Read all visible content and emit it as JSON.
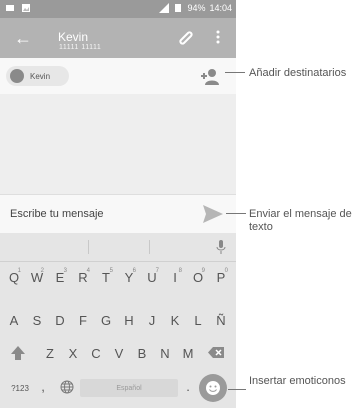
{
  "status": {
    "battery": "94%",
    "time": "14:04"
  },
  "header": {
    "title": "Kevin",
    "subtitle": "11111 11111"
  },
  "recipients": [
    {
      "name": "Kevin"
    }
  ],
  "compose": {
    "placeholder": "Escribe tu mensaje"
  },
  "keyboard": {
    "row1": [
      "Q",
      "W",
      "E",
      "R",
      "T",
      "Y",
      "U",
      "I",
      "O",
      "P"
    ],
    "row1_numbers": [
      "1",
      "2",
      "3",
      "4",
      "5",
      "6",
      "7",
      "8",
      "9",
      "0"
    ],
    "row2": [
      "A",
      "S",
      "D",
      "F",
      "G",
      "H",
      "J",
      "K",
      "L",
      "Ñ"
    ],
    "row3": [
      "Z",
      "X",
      "C",
      "V",
      "B",
      "N",
      "M"
    ],
    "numbers_key": "?123",
    "comma_key": ",",
    "period_key": ".",
    "space_label": "Español"
  },
  "annotations": {
    "add_recipients": "Añadir destinatarios",
    "send_text": "Enviar el mensaje de texto",
    "insert_emoticons": "Insertar emoticonos"
  },
  "colors": {
    "appbar": "#b3b3b3",
    "statusbar": "#9a9a9a",
    "keyboard": "#e5e5e5"
  },
  "icons": {
    "back": "arrow-left-icon",
    "attach": "paperclip-icon",
    "menu": "kebab-menu-icon",
    "add_person": "add-person-icon",
    "send": "send-icon",
    "mic": "microphone-icon",
    "emoji": "smiley-icon",
    "globe": "globe-icon",
    "backspace": "backspace-icon",
    "shift": "shift-icon"
  }
}
